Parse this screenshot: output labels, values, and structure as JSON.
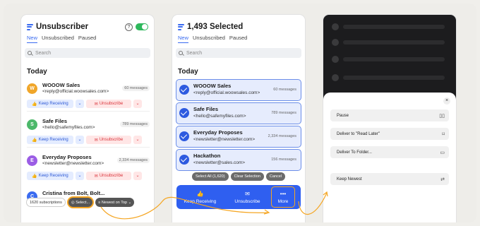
{
  "panel1": {
    "title": "Unsubscriber",
    "help": "?",
    "tabs": [
      "New",
      "Unsubscribed",
      "Paused"
    ],
    "search_placeholder": "Search",
    "section": "Today",
    "rows": [
      {
        "initial": "W",
        "color": "#f0a62a",
        "name": "WOOOW Sales",
        "email": "<reply@official.woowsales.com>",
        "count": "60 messages"
      },
      {
        "initial": "S",
        "color": "#4cb86a",
        "name": "Safe Files",
        "email": "<hello@safemyfiles.com>",
        "count": "789 messages"
      },
      {
        "initial": "E",
        "color": "#9b5de5",
        "name": "Everyday Proposes",
        "email": "<newsletter@newsletter.com>",
        "count": "2,334 messages"
      },
      {
        "initial": "C",
        "color": "#3a6bf0",
        "name": "Cristina from Bolt, Bolt...",
        "email": "",
        "count": ""
      }
    ],
    "keep_label": "Keep Receiving",
    "unsub_label": "Unsubscribe",
    "subscriptions": "1620 subscriptions",
    "select_label": "Select...",
    "sort_label": "Newest on Top"
  },
  "panel2": {
    "title": "1,493 Selected",
    "tabs": [
      "New",
      "Unsubscribed",
      "Paused"
    ],
    "search_placeholder": "Search",
    "section": "Today",
    "rows": [
      {
        "name": "WOOOW Sales",
        "email": "<reply@official.woowsales.com>",
        "count": "60 messages"
      },
      {
        "name": "Safe Files",
        "email": "<hello@safemyfiles.com>",
        "count": "789 messages"
      },
      {
        "name": "Everyday Proposes",
        "email": "<newsletter@newsletter.com>",
        "count": "2,334 messages"
      },
      {
        "name": "Hackathon",
        "email": "<newsletter@sales.com>",
        "count": "156 messages"
      }
    ],
    "select_all": "Select All (1,620)",
    "clear_selection": "Clear Selection",
    "cancel": "Cancel",
    "actions": {
      "keep": "Keep Receiving",
      "unsub": "Unsubscribe",
      "more": "More"
    }
  },
  "panel3": {
    "close": "×",
    "options": [
      "Pause",
      "Deliver to \"Read Later\"",
      "Deliver To Folder...",
      "Keep Newest"
    ],
    "option_icons": [
      "▯▯",
      "⌑",
      "▭",
      "⇄"
    ]
  }
}
